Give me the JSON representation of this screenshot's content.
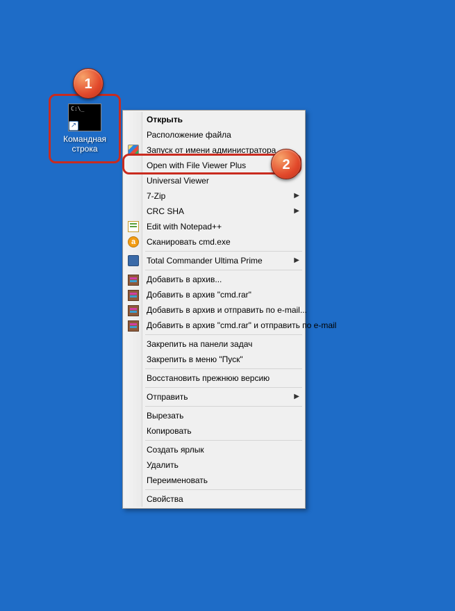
{
  "desktop_icon": {
    "label": "Командная строка"
  },
  "callouts": {
    "badge1": "1",
    "badge2": "2"
  },
  "menu": {
    "open": "Открыть",
    "file_location": "Расположение файла",
    "run_as_admin": "Запуск от имени администратора",
    "open_with_fvp": "Open with File Viewer Plus",
    "universal_viewer": "Universal Viewer",
    "seven_zip": "7-Zip",
    "crc_sha": "CRC SHA",
    "edit_notepad": "Edit with Notepad++",
    "scan_cmd": "Сканировать cmd.exe",
    "total_commander": "Total Commander Ultima Prime",
    "add_archive": "Добавить в архив...",
    "add_cmd_rar": "Добавить в архив \"cmd.rar\"",
    "add_archive_email": "Добавить в архив и отправить по e-mail...",
    "add_cmd_rar_email": "Добавить в архив \"cmd.rar\" и отправить по e-mail",
    "pin_taskbar": "Закрепить на панели задач",
    "pin_start": "Закрепить в меню \"Пуск\"",
    "restore_prev": "Восстановить прежнюю версию",
    "send_to": "Отправить",
    "cut": "Вырезать",
    "copy": "Копировать",
    "create_shortcut": "Создать ярлык",
    "delete": "Удалить",
    "rename": "Переименовать",
    "properties": "Свойства"
  }
}
